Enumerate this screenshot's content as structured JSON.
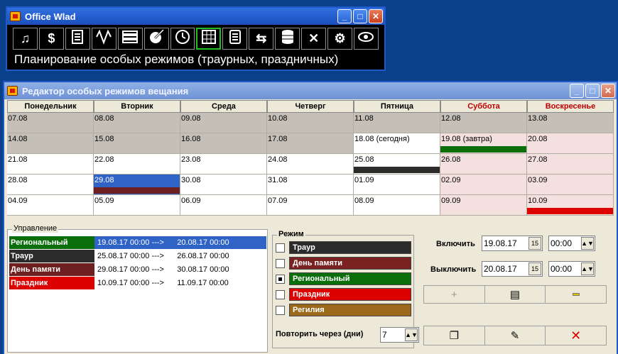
{
  "topwin": {
    "title": "Office Wlad",
    "status": "Планирование особых режимов (траурных, праздничных)",
    "tools": [
      {
        "icon": "music-icon",
        "glyph": "♫",
        "active": false
      },
      {
        "icon": "dollar-icon",
        "glyph": "$",
        "active": false
      },
      {
        "icon": "document-icon",
        "glyph": "",
        "active": false
      },
      {
        "icon": "wave-icon",
        "glyph": "",
        "active": false
      },
      {
        "icon": "list-icon",
        "glyph": "",
        "active": false
      },
      {
        "icon": "edit-icon",
        "glyph": "",
        "active": false
      },
      {
        "icon": "clock-icon",
        "glyph": "",
        "active": false
      },
      {
        "icon": "calendar-icon",
        "glyph": "",
        "active": true
      },
      {
        "icon": "report-icon",
        "glyph": "",
        "active": false
      },
      {
        "icon": "exchange-icon",
        "glyph": "⇆",
        "active": false
      },
      {
        "icon": "database-icon",
        "glyph": "",
        "active": false
      },
      {
        "icon": "tools-icon",
        "glyph": "✕",
        "active": false
      },
      {
        "icon": "gear-icon",
        "glyph": "⚙",
        "active": false
      },
      {
        "icon": "eye-icon",
        "glyph": "",
        "active": false
      }
    ]
  },
  "editor": {
    "title": "Редактор особых режимов вещания",
    "days": [
      "Понедельник",
      "Вторник",
      "Среда",
      "Четверг",
      "Пятница",
      "Суббота",
      "Воскресенье"
    ],
    "weeks": [
      [
        {
          "t": "07.08",
          "s": "grey"
        },
        {
          "t": "08.08",
          "s": "grey"
        },
        {
          "t": "09.08",
          "s": "grey"
        },
        {
          "t": "10.08",
          "s": "grey"
        },
        {
          "t": "11.08",
          "s": "grey"
        },
        {
          "t": "12.08",
          "s": "grey"
        },
        {
          "t": "13.08",
          "s": "grey"
        }
      ],
      [
        {
          "t": "14.08",
          "s": "grey"
        },
        {
          "t": "15.08",
          "s": "grey"
        },
        {
          "t": "16.08",
          "s": "grey"
        },
        {
          "t": "17.08",
          "s": "grey"
        },
        {
          "t": "18.08 (сегодня)",
          "s": "white"
        },
        {
          "t": "19.08 (завтра)",
          "s": "pink",
          "bar": "#0a6e0a"
        },
        {
          "t": "20.08",
          "s": "pink"
        }
      ],
      [
        {
          "t": "21.08",
          "s": "white"
        },
        {
          "t": "22.08",
          "s": "white"
        },
        {
          "t": "23.08",
          "s": "white"
        },
        {
          "t": "24.08",
          "s": "white"
        },
        {
          "t": "25.08",
          "s": "white",
          "bar": "#2b2b2b"
        },
        {
          "t": "26.08",
          "s": "pink"
        },
        {
          "t": "27.08",
          "s": "pink"
        }
      ],
      [
        {
          "t": "28.08",
          "s": "white"
        },
        {
          "t": "29.08",
          "s": "sel",
          "bar": "#6e1f1f"
        },
        {
          "t": "30.08",
          "s": "white"
        },
        {
          "t": "31.08",
          "s": "white"
        },
        {
          "t": "01.09",
          "s": "white"
        },
        {
          "t": "02.09",
          "s": "pink"
        },
        {
          "t": "03.09",
          "s": "pink"
        }
      ],
      [
        {
          "t": "04.09",
          "s": "white"
        },
        {
          "t": "05.09",
          "s": "white"
        },
        {
          "t": "06.09",
          "s": "white"
        },
        {
          "t": "07.09",
          "s": "white"
        },
        {
          "t": "08.09",
          "s": "white"
        },
        {
          "t": "09.09",
          "s": "pink"
        },
        {
          "t": "10.09",
          "s": "pink",
          "bar": "#dd0000"
        }
      ]
    ],
    "control": {
      "legend": "Управление",
      "rows": [
        {
          "label": "Региональный",
          "color": "#0a6e0a",
          "range": "19.08.17 00:00 --->      20.08.17 00:00",
          "active": true
        },
        {
          "label": "Траур",
          "color": "#2b2b2b",
          "range": "25.08.17 00:00 --->      26.08.17 00:00",
          "active": false
        },
        {
          "label": "День памяти",
          "color": "#6e1f1f",
          "range": "29.08.17 00:00 --->      30.08.17 00:00",
          "active": false
        },
        {
          "label": "Праздник",
          "color": "#dd0000",
          "range": "10.09.17 00:00 --->      11.09.17 00:00",
          "active": false
        }
      ]
    },
    "mode": {
      "legend": "Режим",
      "items": [
        {
          "label": "Траур",
          "color": "#2b2b2b",
          "checked": false
        },
        {
          "label": "День памяти",
          "color": "#7a2222",
          "checked": false
        },
        {
          "label": "Региональный",
          "color": "#0a6e0a",
          "checked": true
        },
        {
          "label": "Праздник",
          "color": "#dd0000",
          "checked": false
        },
        {
          "label": "Регилия",
          "color": "#9a6a1a",
          "checked": false
        }
      ]
    },
    "repeat_label": "Повторить через (дни)",
    "repeat_value": "7",
    "enable_label": "Включить",
    "enable_date": "19.08.17",
    "enable_time": "00:00",
    "disable_label": "Выключить",
    "disable_date": "20.08.17",
    "disable_time": "00:00",
    "calendar_btn": "15"
  }
}
